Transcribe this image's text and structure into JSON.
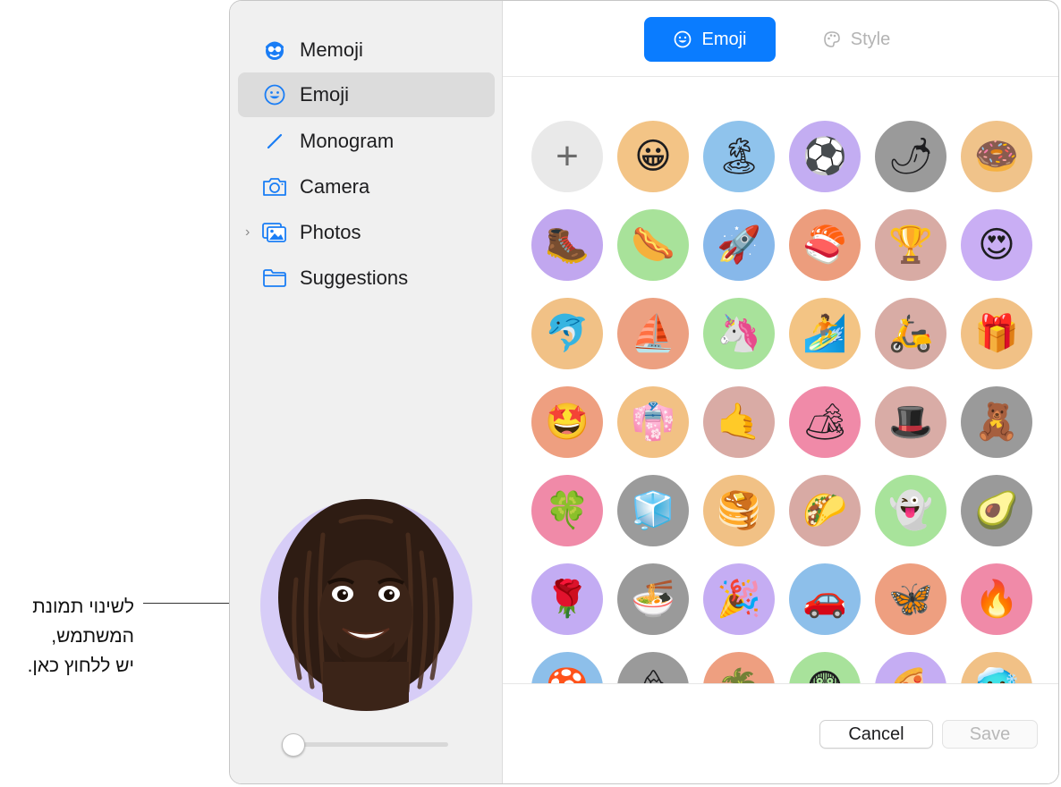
{
  "callout": {
    "line1": "לשינוי תמונת",
    "line2": "המשתמש,",
    "line3": "יש ללחוץ כאן."
  },
  "sidebar": {
    "items": [
      {
        "label": "Memoji",
        "icon": "memoji-icon",
        "selected": false
      },
      {
        "label": "Emoji",
        "icon": "smiley-icon",
        "selected": true
      },
      {
        "label": "Monogram",
        "icon": "pencil-icon",
        "selected": false
      },
      {
        "label": "Camera",
        "icon": "camera-icon",
        "selected": false
      },
      {
        "label": "Photos",
        "icon": "photos-icon",
        "selected": false,
        "expandable": true
      },
      {
        "label": "Suggestions",
        "icon": "folder-icon",
        "selected": false
      }
    ],
    "slider_value": 0
  },
  "segmented": {
    "emoji_label": "Emoji",
    "style_label": "Style",
    "selected": "Emoji"
  },
  "emoji_grid": [
    {
      "glyph": "+",
      "bg": "#e9e9e9",
      "add": true
    },
    {
      "glyph": "😀",
      "bg": "#f3c486"
    },
    {
      "glyph": "🏝",
      "bg": "#8fc3ec"
    },
    {
      "glyph": "⚽",
      "bg": "#c3adf2"
    },
    {
      "glyph": "🌶",
      "bg": "#9a9a9a"
    },
    {
      "glyph": "🍩",
      "bg": "#f0c38a"
    },
    {
      "glyph": "🥾",
      "bg": "#c1a7ef"
    },
    {
      "glyph": "🌭",
      "bg": "#a8e29a"
    },
    {
      "glyph": "🚀",
      "bg": "#87b8ea"
    },
    {
      "glyph": "🍣",
      "bg": "#ec9d7d"
    },
    {
      "glyph": "🏆",
      "bg": "#d8aba4"
    },
    {
      "glyph": "😍",
      "bg": "#c9aef4"
    },
    {
      "glyph": "🐬",
      "bg": "#f1c186"
    },
    {
      "glyph": "⛵",
      "bg": "#eca081"
    },
    {
      "glyph": "🦄",
      "bg": "#a8e29b"
    },
    {
      "glyph": "🏄",
      "bg": "#f3c484"
    },
    {
      "glyph": "🛵",
      "bg": "#d8aca5"
    },
    {
      "glyph": "🎁",
      "bg": "#f1c186"
    },
    {
      "glyph": "🤩",
      "bg": "#ee9f80"
    },
    {
      "glyph": "👘",
      "bg": "#f2c184"
    },
    {
      "glyph": "🤙",
      "bg": "#d9aba5"
    },
    {
      "glyph": "🏕",
      "bg": "#f08aa8"
    },
    {
      "glyph": "🎩",
      "bg": "#d9aca6"
    },
    {
      "glyph": "🧸",
      "bg": "#9a9a9a"
    },
    {
      "glyph": "🍀",
      "bg": "#f08aa8"
    },
    {
      "glyph": "🧊",
      "bg": "#9b9b9b"
    },
    {
      "glyph": "🥞",
      "bg": "#f1c185"
    },
    {
      "glyph": "🌮",
      "bg": "#d8aaa4"
    },
    {
      "glyph": "👻",
      "bg": "#a8e39b"
    },
    {
      "glyph": "🥑",
      "bg": "#9a9a9a"
    },
    {
      "glyph": "🌹",
      "bg": "#c3acf3"
    },
    {
      "glyph": "🍜",
      "bg": "#9a9a9a"
    },
    {
      "glyph": "🎉",
      "bg": "#c5adf3"
    },
    {
      "glyph": "🚗",
      "bg": "#8dbfea"
    },
    {
      "glyph": "🦋",
      "bg": "#ee9f80"
    },
    {
      "glyph": "🔥",
      "bg": "#f08aa8"
    },
    {
      "glyph": "🍄",
      "bg": "#8dbfea"
    },
    {
      "glyph": "🏔",
      "bg": "#9a9a9a"
    },
    {
      "glyph": "🌴",
      "bg": "#ee9f80"
    },
    {
      "glyph": "😨",
      "bg": "#a8e29b"
    },
    {
      "glyph": "🍕",
      "bg": "#c5adf3"
    },
    {
      "glyph": "🥶",
      "bg": "#f1c186"
    }
  ],
  "buttons": {
    "cancel": "Cancel",
    "save": "Save"
  },
  "colors": {
    "accent": "#0a7cff",
    "sidebar_bg": "#f0f0f0",
    "avatar_bg": "#d7cdf7"
  }
}
